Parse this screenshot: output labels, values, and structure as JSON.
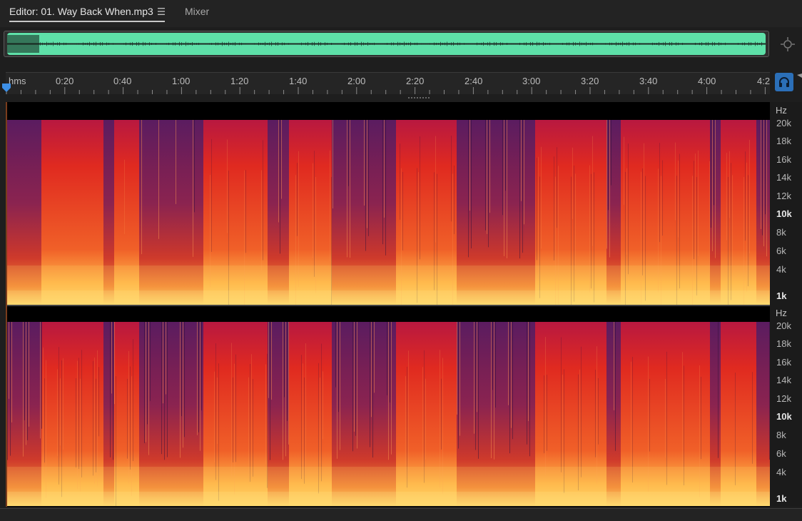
{
  "tabs": {
    "editor_label": "Editor: 01. Way Back When.mp3",
    "mixer_label": "Mixer"
  },
  "ruler": {
    "unit_label": "hms",
    "time_labels": [
      "0:20",
      "0:40",
      "1:00",
      "1:20",
      "1:40",
      "2:00",
      "2:20",
      "2:40",
      "3:00",
      "3:20",
      "3:40",
      "4:00",
      "4:2"
    ]
  },
  "frequency_scale": {
    "unit_label": "Hz",
    "labels": [
      "20k",
      "18k",
      "16k",
      "14k",
      "12k",
      "10k",
      "8k",
      "6k",
      "4k",
      "1k"
    ],
    "emphasized": [
      "10k",
      "1k"
    ]
  },
  "colors": {
    "overview_waveform": "#5ee0a8",
    "spectrogram_low": "#ffd86a",
    "spectrogram_mid": "#e02a20",
    "spectrogram_high": "#4a1d66",
    "headphones_button": "#2b6fb8",
    "playhead": "#3d8fe6"
  },
  "icons": {
    "tab_menu": "hamburger-menu-icon",
    "zoom_nav": "zoom-navigator-icon",
    "playhead": "playhead-marker-icon",
    "monitor": "headphones-icon"
  }
}
